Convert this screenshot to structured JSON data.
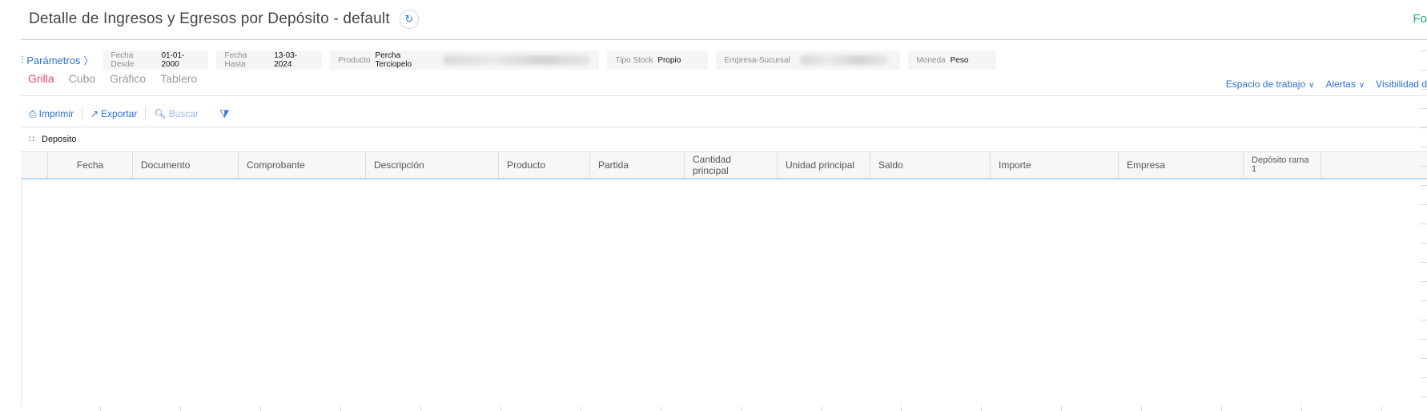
{
  "header": {
    "title": "Detalle de Ingresos y Egresos por Depósito - default",
    "refresh_icon": "refresh-icon",
    "right_text": "Fo"
  },
  "params": {
    "toggle_label": "Parámetros",
    "toggle_icon": "sliders-icon",
    "items": [
      {
        "label": "Fecha Desde",
        "value": "01-01-2000"
      },
      {
        "label": "Fecha Hasta",
        "value": "13-03-2024"
      },
      {
        "label": "Producto",
        "value": "Percha Terciopelo"
      },
      {
        "label": "Tipo Stock",
        "value": "Propio"
      },
      {
        "label": "Empresa-Sucursal",
        "value": ""
      },
      {
        "label": "Moneda",
        "value": "Peso"
      }
    ]
  },
  "view_tabs": [
    {
      "label": "Grilla",
      "active": true
    },
    {
      "label": "Cubo",
      "active": false
    },
    {
      "label": "Gráfico",
      "active": false
    },
    {
      "label": "Tablero",
      "active": false
    }
  ],
  "right_links": [
    {
      "label": "Espacio de trabajo"
    },
    {
      "label": "Alertas"
    },
    {
      "label": "Visibilidad d"
    }
  ],
  "toolbar": {
    "print_label": "Imprimir",
    "export_label": "Exportar",
    "search_label": "Buscar",
    "filter_icon": "filter-icon"
  },
  "group": {
    "label": "Deposito",
    "icon": "grid-dots-icon"
  },
  "table": {
    "columns": [
      "Fecha",
      "Documento",
      "Comprobante",
      "Descripción",
      "Producto",
      "Partida",
      "Cantidad principal",
      "Unidad principal",
      "Saldo",
      "Importe",
      "Empresa",
      "Depósito rama 1"
    ],
    "rows": []
  },
  "colors": {
    "accent": "#2f6fd6",
    "active_tab": "#e84a6b",
    "right_text": "#1aae7a"
  }
}
